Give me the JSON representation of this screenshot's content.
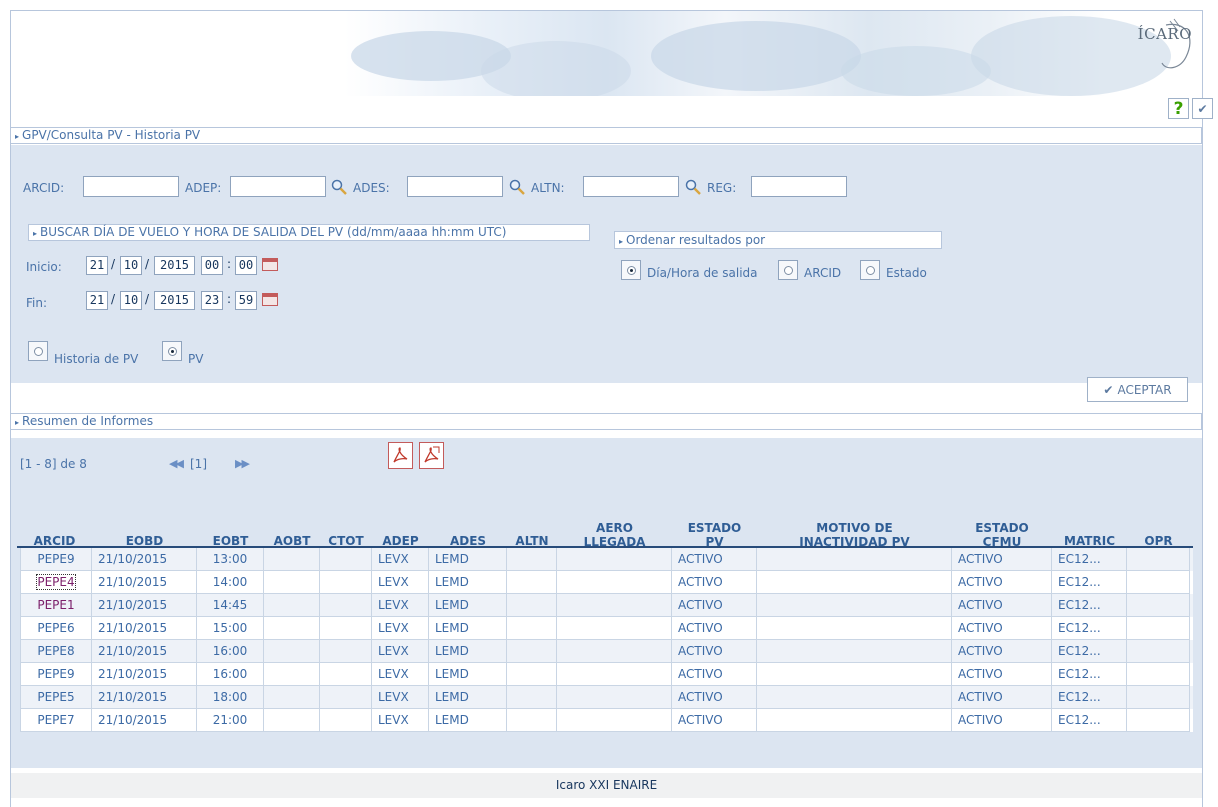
{
  "app": {
    "logo_text": "ÍCARO"
  },
  "toolbar": {
    "help_label": "?",
    "confirm_label": "✔"
  },
  "breadcrumb": "GPV/Consulta PV - Historia PV",
  "filters": {
    "arcid_label": "ARCID:",
    "adep_label": "ADEP:",
    "ades_label": "ADES:",
    "altn_label": "ALTN:",
    "reg_label": "REG:",
    "arcid_value": "",
    "adep_value": "",
    "ades_value": "",
    "altn_value": "",
    "reg_value": ""
  },
  "date_search": {
    "title": "BUSCAR DÍA DE VUELO Y HORA DE SALIDA DEL PV (dd/mm/aaaa hh:mm UTC)",
    "start_label": "Inicio:",
    "end_label": "Fin:",
    "start": {
      "day": "21",
      "month": "10",
      "year": "2015",
      "hour": "00",
      "minute": "00"
    },
    "end": {
      "day": "21",
      "month": "10",
      "year": "2015",
      "hour": "23",
      "minute": "59"
    }
  },
  "mode": {
    "options": [
      {
        "label": "Historia de PV",
        "selected": false
      },
      {
        "label": "PV",
        "selected": true
      }
    ]
  },
  "order": {
    "title": "Ordenar resultados por",
    "options": [
      {
        "label": "Día/Hora de salida",
        "selected": true
      },
      {
        "label": "ARCID",
        "selected": false
      },
      {
        "label": "Estado",
        "selected": false
      }
    ]
  },
  "accept_label": "ACEPTAR",
  "results": {
    "title": "Resumen de Informes",
    "range_text": "[1 - 8] de 8",
    "page_text": "[1]",
    "columns": [
      [
        "ARCID"
      ],
      [
        "EOBD"
      ],
      [
        "EOBT"
      ],
      [
        "AOBT"
      ],
      [
        "CTOT"
      ],
      [
        "ADEP"
      ],
      [
        "ADES"
      ],
      [
        "ALTN"
      ],
      [
        "AERO",
        "LLEGADA"
      ],
      [
        "ESTADO",
        "PV"
      ],
      [
        "MOTIVO DE",
        "INACTIVIDAD PV"
      ],
      [
        "ESTADO",
        "CFMU"
      ],
      [
        "MATRIC"
      ],
      [
        "OPR"
      ]
    ],
    "rows": [
      [
        "PEPE9",
        "21/10/2015",
        "13:00",
        "",
        "",
        "LEVX",
        "LEMD",
        "",
        "",
        "ACTIVO",
        "",
        "ACTIVO",
        "EC12...",
        ""
      ],
      [
        "PEPE4",
        "21/10/2015",
        "14:00",
        "",
        "",
        "LEVX",
        "LEMD",
        "",
        "",
        "ACTIVO",
        "",
        "ACTIVO",
        "EC12...",
        ""
      ],
      [
        "PEPE1",
        "21/10/2015",
        "14:45",
        "",
        "",
        "LEVX",
        "LEMD",
        "",
        "",
        "ACTIVO",
        "",
        "ACTIVO",
        "EC12...",
        ""
      ],
      [
        "PEPE6",
        "21/10/2015",
        "15:00",
        "",
        "",
        "LEVX",
        "LEMD",
        "",
        "",
        "ACTIVO",
        "",
        "ACTIVO",
        "EC12...",
        ""
      ],
      [
        "PEPE8",
        "21/10/2015",
        "16:00",
        "",
        "",
        "LEVX",
        "LEMD",
        "",
        "",
        "ACTIVO",
        "",
        "ACTIVO",
        "EC12...",
        ""
      ],
      [
        "PEPE9",
        "21/10/2015",
        "16:00",
        "",
        "",
        "LEVX",
        "LEMD",
        "",
        "",
        "ACTIVO",
        "",
        "ACTIVO",
        "EC12...",
        ""
      ],
      [
        "PEPE5",
        "21/10/2015",
        "18:00",
        "",
        "",
        "LEVX",
        "LEMD",
        "",
        "",
        "ACTIVO",
        "",
        "ACTIVO",
        "EC12...",
        ""
      ],
      [
        "PEPE7",
        "21/10/2015",
        "21:00",
        "",
        "",
        "LEVX",
        "LEMD",
        "",
        "",
        "ACTIVO",
        "",
        "ACTIVO",
        "EC12...",
        ""
      ]
    ]
  },
  "footer": "Icaro XXI ENAIRE",
  "colors": {
    "panel_bg": "#dce5f1",
    "accent": "#4a73a8",
    "header_text": "#2f5d95"
  }
}
